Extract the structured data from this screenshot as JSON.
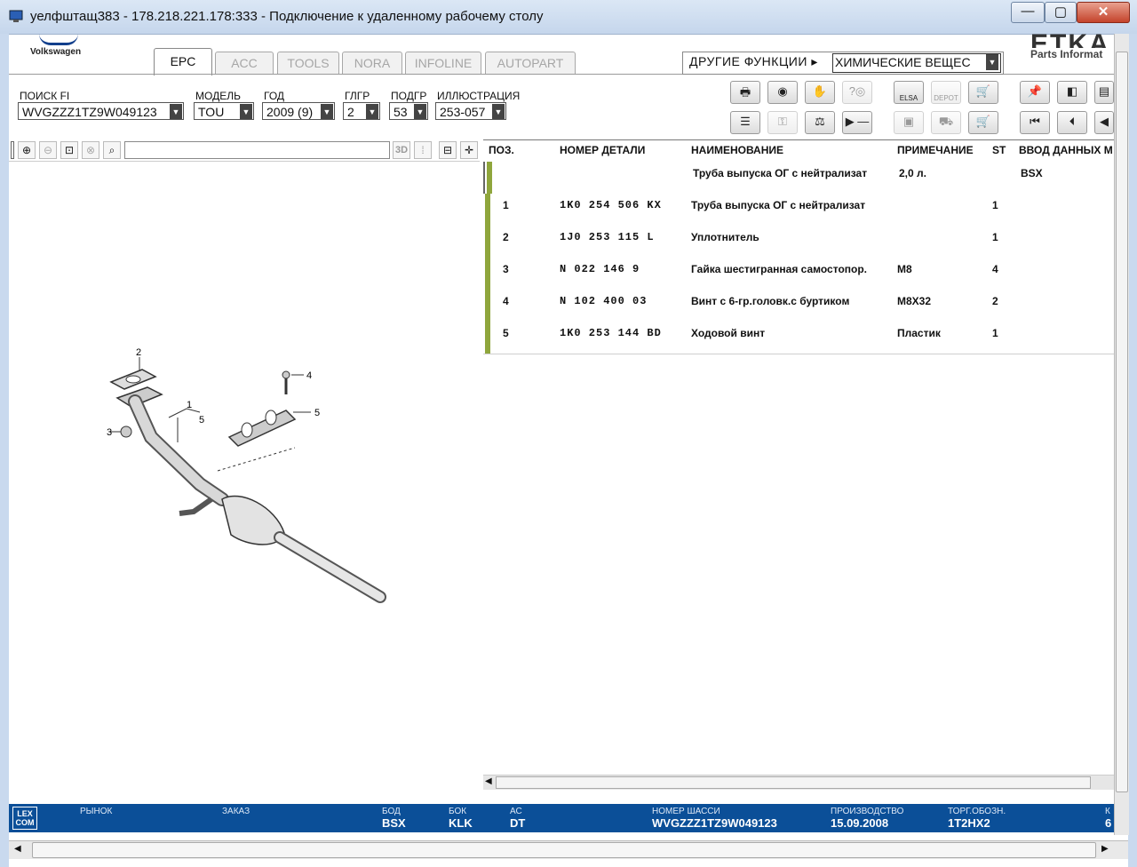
{
  "window": {
    "title": "уелфштащ383 - 178.218.221.178:333 - Подключение к удаленному рабочему столу",
    "minimize": "—",
    "maximize": "▢",
    "close": "✕"
  },
  "brand": {
    "name": "Volkswagen",
    "etka": "ETKA",
    "etka_sub": "Parts Informat"
  },
  "tabs": [
    "EPC",
    "ACC",
    "TOOLS",
    "NORA",
    "INFOLINE",
    "AUTOPART"
  ],
  "active_tab": "EPC",
  "other_functions": {
    "label": "ДРУГИЕ ФУНКЦИИ ▸",
    "value": "ХИМИЧЕСКИЕ ВЕЩЕС"
  },
  "filters": {
    "search_fi": {
      "label": "ПОИСК FI",
      "value": "WVGZZZ1TZ9W049123"
    },
    "model": {
      "label": "МОДЕЛЬ",
      "value": "TOU"
    },
    "year": {
      "label": "ГОД",
      "value": "2009 (9)"
    },
    "main_group": {
      "label": "ГЛГР",
      "value": "2"
    },
    "sub_group": {
      "label": "ПОДГР",
      "value": "53"
    },
    "illustration": {
      "label": "ИЛЛЮСТРАЦИЯ",
      "value": "253-057"
    }
  },
  "toolbar": {
    "elsa": "ELSA",
    "depot": "DEPOT"
  },
  "image_tools": {
    "three_d": "3D"
  },
  "diagram_callouts": [
    "2",
    "1",
    "5",
    "4",
    "5",
    "3"
  ],
  "table": {
    "headers": [
      "ПОЗ.",
      "НОМЕР ДЕТАЛИ",
      "НАИМЕНОВАНИЕ",
      "ПРИМЕЧАНИЕ",
      "ST",
      "ВВОД ДАННЫХ М"
    ],
    "header_row": {
      "name": "Труба выпуска ОГ с нейтрализат",
      "note": "2,0 л.",
      "data": "BSX"
    },
    "rows": [
      {
        "pos": "1",
        "part": "1K0  254  506  KX",
        "name": "Труба выпуска ОГ с нейтрализат",
        "note": "",
        "st": "1"
      },
      {
        "pos": "2",
        "part": "1J0  253  115  L",
        "name": "Уплотнитель",
        "note": "",
        "st": "1"
      },
      {
        "pos": "3",
        "part": "N    022  146  9",
        "name": "Гайка шестигранная самостопор.",
        "note": "M8",
        "st": "4"
      },
      {
        "pos": "4",
        "part": "N    102  400  03",
        "name": "Винт с 6-гр.головк.с буртиком",
        "note": "M8X32",
        "st": "2"
      },
      {
        "pos": "5",
        "part": "1K0  253  144  BD",
        "name": "Ходовой винт",
        "note": "Пластик",
        "st": "1"
      }
    ]
  },
  "footer": {
    "logo": "LEX COM",
    "market": {
      "label": "РЫНОК",
      "value": ""
    },
    "order": {
      "label": "ЗАКАЗ",
      "value": ""
    },
    "bod": {
      "label": "БОД",
      "value": "BSX"
    },
    "bok": {
      "label": "БОК",
      "value": "KLK"
    },
    "ac": {
      "label": "АС",
      "value": "DT"
    },
    "chassis": {
      "label": "НОМЕР ШАССИ",
      "value": "WVGZZZ1TZ9W049123"
    },
    "production": {
      "label": "ПРОИЗВОДСТВО",
      "value": "15.09.2008"
    },
    "trade": {
      "label": "ТОРГ.ОБОЗН.",
      "value": "1T2HX2"
    },
    "k": {
      "label": "К",
      "value": "6"
    }
  },
  "colors": {
    "accent_bar": "#8fa63c",
    "footer_bg": "#0b4f98",
    "titlebar": "#c5d6ec"
  }
}
